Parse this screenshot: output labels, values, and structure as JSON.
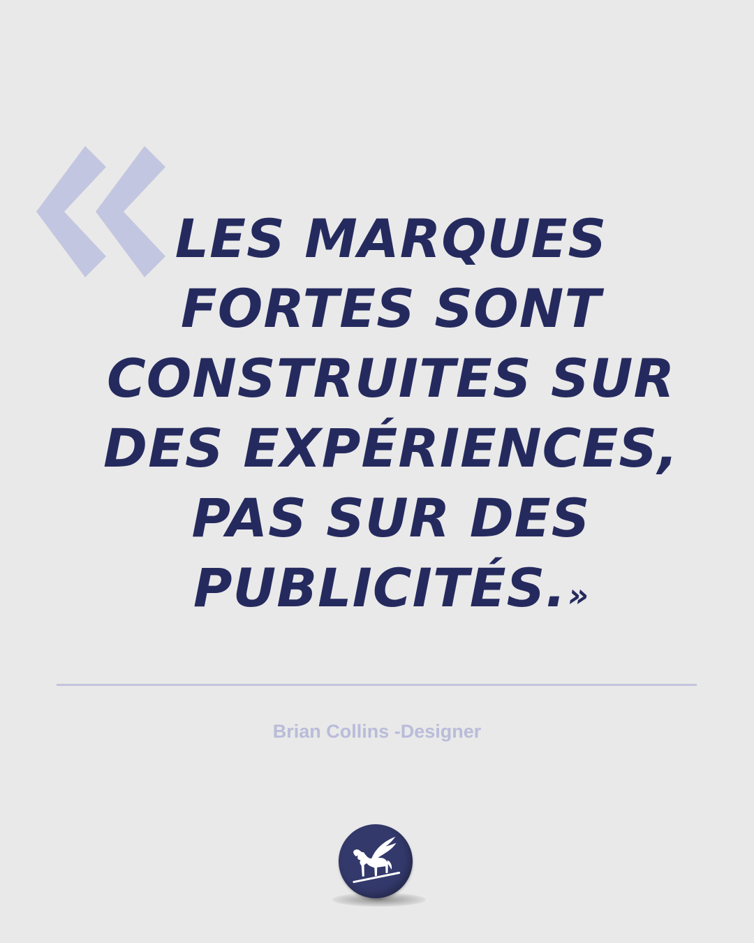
{
  "quote": {
    "lines": [
      "LES MARQUES",
      "FORTES SONT",
      "CONSTRUITES SUR",
      "DES EXPÉRIENCES,",
      "PAS SUR DES",
      "PUBLICITÉS."
    ],
    "close_mark": "»",
    "open_mark_icon": "double-chevron-left-icon",
    "text_color": "#252a5e",
    "accent_color": "#c3c6e0"
  },
  "author": {
    "text": "Brian Collins -Designer",
    "color": "#b9bcd9"
  },
  "logo": {
    "icon": "winged-horse-icon",
    "badge_color": "#33396b"
  },
  "background_color": "#e9e9e9"
}
